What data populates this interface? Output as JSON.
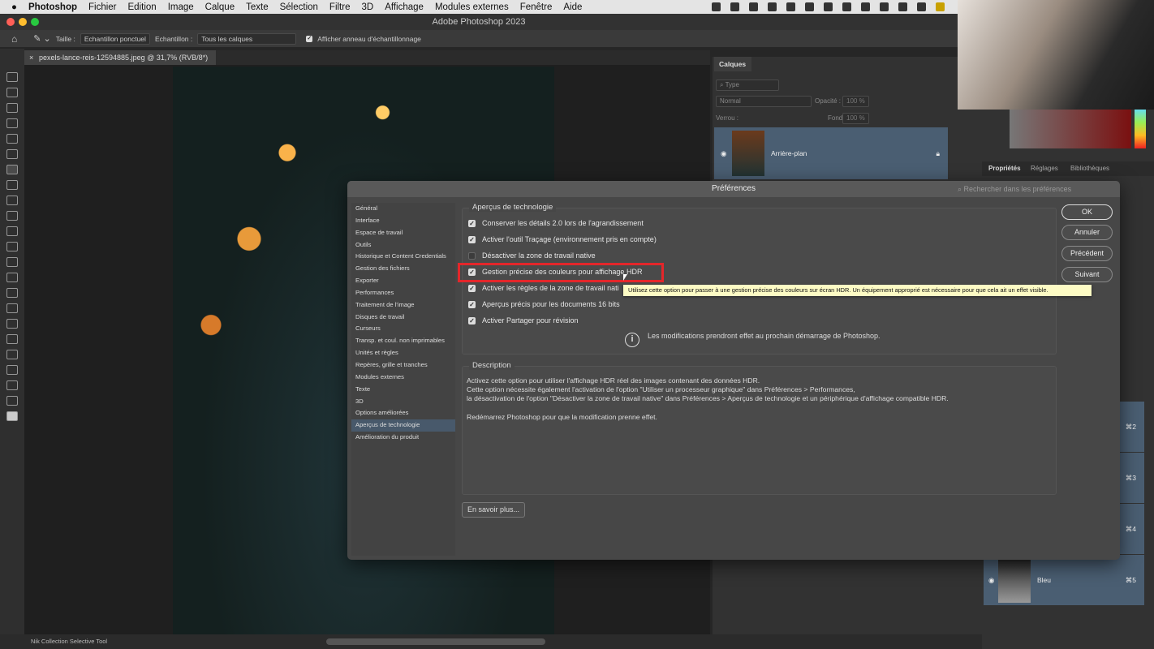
{
  "menubar": {
    "app": "Photoshop",
    "items": [
      "Fichier",
      "Edition",
      "Image",
      "Calque",
      "Texte",
      "Sélection",
      "Filtre",
      "3D",
      "Affichage",
      "Modules externes",
      "Fenêtre",
      "Aide"
    ]
  },
  "window": {
    "title": "Adobe Photoshop 2023"
  },
  "options": {
    "size_label": "Taille :",
    "size_value": "Echantillon ponctuel",
    "sample_label": "Echantillon :",
    "sample_value": "Tous les calques",
    "ring_label": "Afficher anneau d'échantillonnage",
    "ring_checked": true
  },
  "document": {
    "tab": "pexels-lance-reis-12594885.jpeg @ 31,7% (RVB/8*)"
  },
  "layers": {
    "title": "Calques",
    "search": "Type",
    "blend": "Normal",
    "opacity_label": "Opacité :",
    "opacity": "100 %",
    "lock_label": "Verrou :",
    "fill_label": "Fond :",
    "fill": "100 %",
    "layer_name": "Arrière-plan"
  },
  "props_tabs": [
    "Propriétés",
    "Réglages",
    "Bibliothèques"
  ],
  "channels": [
    {
      "name": "",
      "shortcut": "⌘2"
    },
    {
      "name": "",
      "shortcut": "⌘3"
    },
    {
      "name": "",
      "shortcut": "⌘4"
    },
    {
      "name": "Bleu",
      "shortcut": "⌘5"
    }
  ],
  "status": {
    "plugin": "Nik Collection Selective Tool"
  },
  "dialog": {
    "title": "Préférences",
    "search_placeholder": "Rechercher dans les préférences",
    "nav": [
      "Général",
      "Interface",
      "Espace de travail",
      "Outils",
      "Historique et Content Credentials",
      "Gestion des fichiers",
      "Exporter",
      "Performances",
      "Traitement de l'image",
      "Disques de travail",
      "Curseurs",
      "Transp. et coul. non imprimables",
      "Unités et règles",
      "Repères, grille et tranches",
      "Modules externes",
      "Texte",
      "3D",
      "Options améliorées",
      "Aperçus de technologie",
      "Amélioration du produit"
    ],
    "selected_nav": "Aperçus de technologie",
    "group_title": "Aperçus de technologie",
    "options": [
      {
        "label": "Conserver les détails 2.0 lors de l'agrandissement",
        "checked": true
      },
      {
        "label": "Activer l'outil Traçage (environnement pris en compte)",
        "checked": true
      },
      {
        "label": "Désactiver la zone de travail native",
        "checked": false
      },
      {
        "label": "Gestion précise des couleurs pour affichage HDR",
        "checked": true
      },
      {
        "label": "Activer les règles de la zone de travail nati",
        "checked": true
      },
      {
        "label": "Aperçus précis pour les documents 16 bits",
        "checked": true
      },
      {
        "label": "Activer Partager pour révision",
        "checked": true
      }
    ],
    "notice": "Les modifications prendront effet au prochain démarrage de Photoshop.",
    "description_title": "Description",
    "description": [
      "Activez cette option pour utiliser l'affichage HDR réel des images contenant des données HDR.",
      "Cette option nécessite également l'activation de l'option \"Utiliser un processeur graphique\" dans Préférences > Performances,",
      "la désactivation de l'option \"Désactiver la zone de travail native\" dans Préférences > Aperçus de technologie et un périphérique d'affichage compatible HDR.",
      "",
      "Redémarrez Photoshop pour que la modification prenne effet."
    ],
    "learn_more": "En savoir plus...",
    "buttons": {
      "ok": "OK",
      "cancel": "Annuler",
      "prev": "Précédent",
      "next": "Suivant"
    },
    "tooltip": "Utilisez cette option pour passer à une gestion précise des couleurs sur écran HDR. Un équipement approprié est nécessaire pour que cela ait un effet visible.",
    "highlight_color": "#e4262a"
  }
}
